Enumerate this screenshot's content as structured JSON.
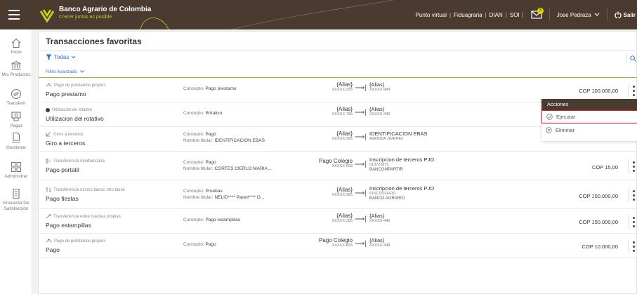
{
  "header": {
    "brand_name": "Banco Agrario de Colombia",
    "slogan": "Crecer juntos es posible",
    "links": [
      "Punto virtual",
      "Fiduagraria",
      "DIAN",
      "SOI"
    ],
    "notifications_count": "3",
    "user_name": "Jose Pedraza",
    "logout_label": "Salir"
  },
  "sidebar": {
    "items": [
      {
        "label": "Inicio",
        "icon": "home-icon"
      },
      {
        "label": "Mis Productos",
        "icon": "bank-icon"
      },
      {
        "label": "Transferir",
        "icon": "transfer-icon"
      },
      {
        "label": "Pagar",
        "icon": "pay-icon"
      },
      {
        "label": "Gestionar",
        "icon": "manage-icon"
      },
      {
        "label": "Administrar",
        "icon": "grid-icon"
      },
      {
        "label": "Encuesta De Satisfacción",
        "icon": "survey-icon"
      }
    ]
  },
  "main": {
    "title": "Transacciones favoritas",
    "filter_label": "Todas",
    "advanced_filter": "Filtro Avanzado",
    "concept_prefix": "Concepto:",
    "holder_prefix": "Nombre titular:",
    "rows": [
      {
        "type": "Pago de préstamos propios",
        "name": "Pago prestamo",
        "concept": "Pago prestamo",
        "holder": "",
        "from_alias": "{Alias}",
        "from_num": "XXXXX-395",
        "to_alias": "{Alias}",
        "to_num": "XXXXX-984",
        "to_bank": "",
        "amount": "COP 100.000,00"
      },
      {
        "type": "Utilización de rotativo",
        "name": "Utilizacion del rotativo",
        "concept": "Rotativo",
        "holder": "",
        "from_alias": "{Alias}",
        "from_num": "XXXXX-766",
        "to_alias": "{Alias}",
        "to_num": "XXXXX-446",
        "to_bank": "",
        "amount": ""
      },
      {
        "type": "Giros a terceros",
        "name": "Giro a terceros",
        "concept": "Pago",
        "holder": "IDENTIFICACION EBAS",
        "from_alias": "{Alias}",
        "from_num": "XXXXX-395",
        "to_alias": "IDENTIFICACION EBAS",
        "to_num": "AVENIDA JIMENEZ",
        "to_bank": "",
        "amount": ""
      },
      {
        "type": "Transferencia interbancaria",
        "name": "Pago portatil",
        "concept": "Pago",
        "holder": "CORTES CIERLO MARIA ...",
        "from_alias": "Pago Colegio",
        "from_num": "XXXXX-693",
        "to_alias": "Inscripcion de terceros PJO",
        "to_num": "013722875",
        "to_bank": "BANCOMPARTIR",
        "amount": "COP 15,00"
      },
      {
        "type": "Transferencia mismo banco otro titular",
        "name": "Pago fiestas",
        "concept": "Pruebas",
        "holder": "NELID**** Pared**** O...",
        "from_alias": "{Alias}",
        "from_num": "XXXXX-395",
        "to_alias": "Inscripcion de terceros PJO",
        "to_num": "615122026410",
        "to_bank": "BANCO AGRARIO",
        "amount": "COP 150.000,00"
      },
      {
        "type": "Transferencia entre cuentas propias",
        "name": "Pago estampillas",
        "concept": "Pago estampillas",
        "holder": "",
        "from_alias": "{Alias}",
        "from_num": "XXXXX-395",
        "to_alias": "{Alias}",
        "to_num": "XXXXX-446",
        "to_bank": "",
        "amount": "COP 150.000,00"
      },
      {
        "type": "Pago de préstamos propios",
        "name": "Pago",
        "concept": "Pago",
        "holder": "",
        "from_alias": "Pago Colegio",
        "from_num": "XXXXX-693",
        "to_alias": "{Alias}",
        "to_num": "XXXXX-448",
        "to_bank": "",
        "amount": "COP 10.000,00"
      }
    ]
  },
  "popup": {
    "title": "Acciones",
    "execute": "Ejecutar",
    "delete": "Eliminar"
  },
  "colors": {
    "header_bg": "#4a3a30",
    "accent_green": "#9bbb2f",
    "link_blue": "#2a72c9",
    "highlight_red": "#e31b23"
  }
}
